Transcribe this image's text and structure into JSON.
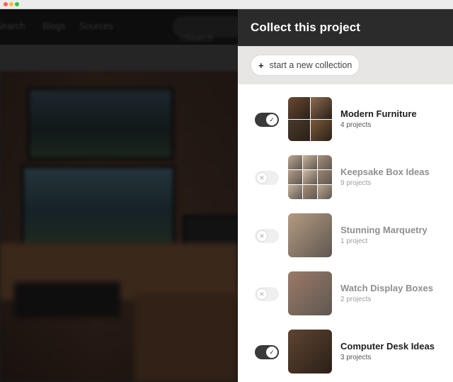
{
  "background": {
    "nav": [
      "Search",
      "Blogs",
      "Sources"
    ],
    "search_label": "Search"
  },
  "panel": {
    "title": "Collect this project",
    "new_collection_label": "start a new collection",
    "collections": [
      {
        "name": "Modern Furniture",
        "count": "4 projects",
        "selected": true,
        "thumb_layout": "grid4",
        "thumb_colors": [
          "#6b4a32",
          "#8c6a4e",
          "#4a3a2c",
          "#7b5a3a"
        ]
      },
      {
        "name": "Keepsake Box Ideas",
        "count": "9 projects",
        "selected": false,
        "thumb_layout": "grid9",
        "thumb_colors": [
          "#a88a6c",
          "#b89a7c",
          "#8c6c4e",
          "#9c7c5e",
          "#c4a486",
          "#7c5c40",
          "#b49878",
          "#8a6a4c",
          "#a8886a"
        ]
      },
      {
        "name": "Stunning Marquetry",
        "count": "1 project",
        "selected": false,
        "thumb_layout": "single",
        "thumb_colors": [
          "#9c7a56"
        ]
      },
      {
        "name": "Watch Display Boxes",
        "count": "2 projects",
        "selected": false,
        "thumb_layout": "single",
        "thumb_colors": [
          "#7a4e34"
        ]
      },
      {
        "name": "Computer Desk Ideas",
        "count": "3 projects",
        "selected": true,
        "thumb_layout": "single",
        "thumb_colors": [
          "#5e4430"
        ]
      }
    ]
  },
  "colors": {
    "header_bg": "#2b2b2b",
    "toolbar_bg": "#e7e6e4",
    "toggle_on": "#3a3a3a",
    "toggle_off": "#efefef"
  }
}
